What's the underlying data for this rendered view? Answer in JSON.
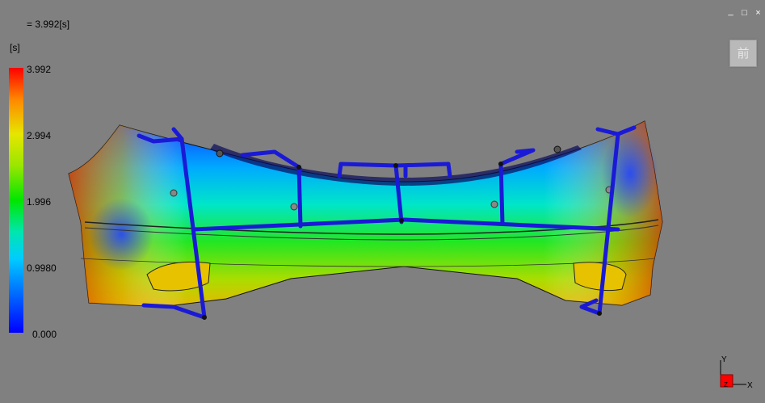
{
  "header": {
    "time_readout": "= 3.992[s]"
  },
  "legend": {
    "unit": "[s]",
    "ticks": [
      "3.992",
      "2.994",
      "1.996",
      "0.9980",
      "0.000"
    ]
  },
  "window_controls": {
    "minimize": "_",
    "restore": "□",
    "close": "×"
  },
  "view_cube": {
    "label": "前"
  },
  "axes": {
    "y_label": "Y",
    "x_label": "X",
    "z_label": "Z"
  },
  "colors": {
    "background": "#808080",
    "frame": "#1a1ad6"
  }
}
